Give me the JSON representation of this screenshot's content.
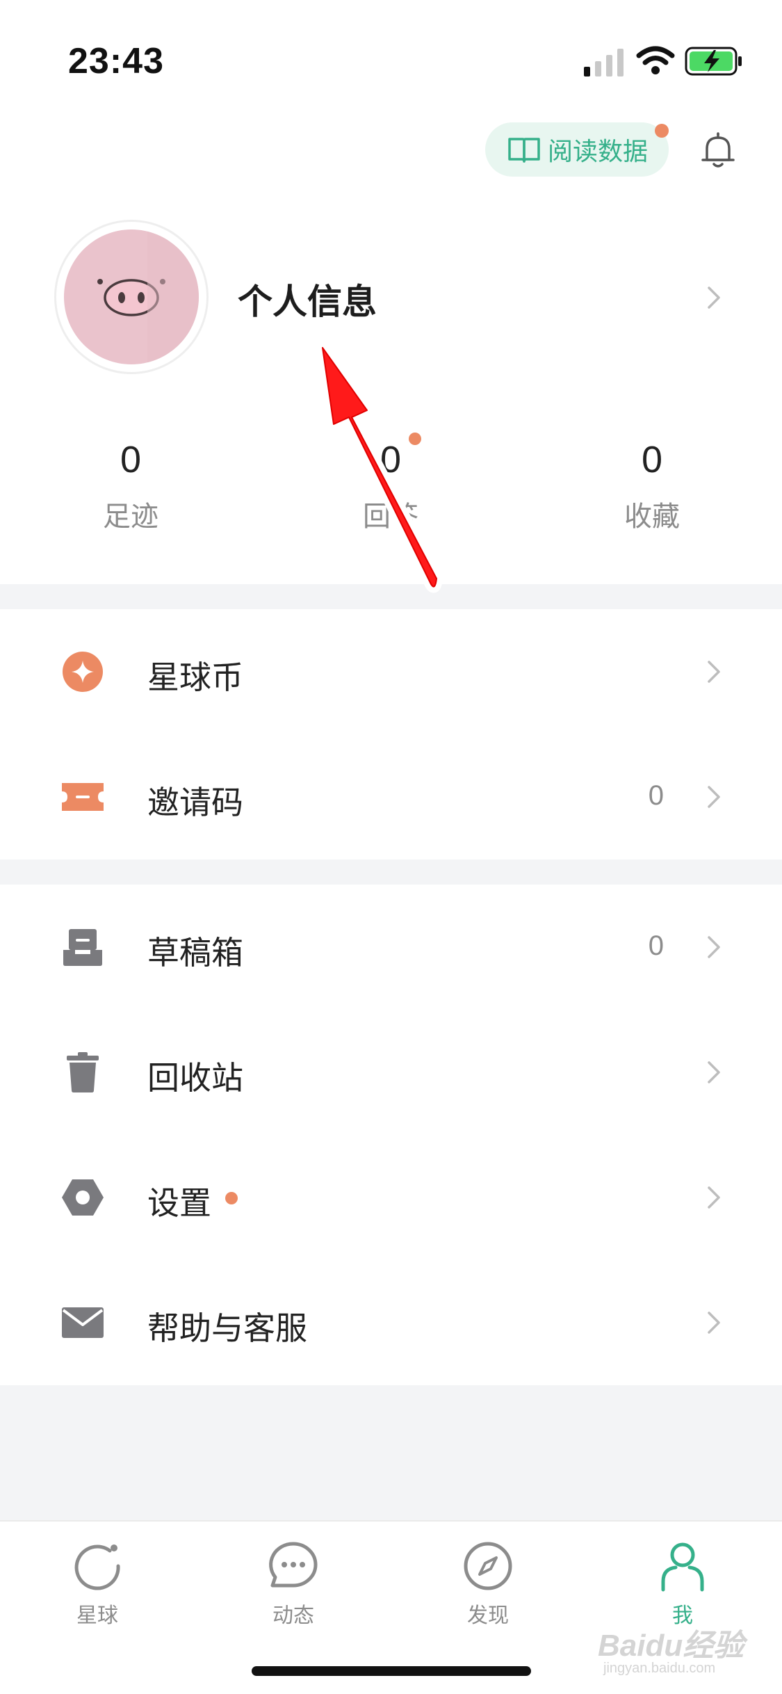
{
  "status_bar": {
    "time": "23:43"
  },
  "header": {
    "read_data_label": "阅读数据"
  },
  "profile": {
    "title": "个人信息"
  },
  "stats": [
    {
      "value": "0",
      "label": "足迹"
    },
    {
      "value": "0",
      "label": "回答"
    },
    {
      "value": "0",
      "label": "收藏"
    }
  ],
  "menu": {
    "coins": {
      "label": "星球币",
      "icon": "star-coin-icon"
    },
    "invite": {
      "label": "邀请码",
      "value": "0",
      "icon": "ticket-icon"
    },
    "drafts": {
      "label": "草稿箱",
      "value": "0",
      "icon": "inbox-tray-icon"
    },
    "trash": {
      "label": "回收站",
      "icon": "trash-icon"
    },
    "settings": {
      "label": "设置",
      "icon": "hexagon-settings-icon"
    },
    "help": {
      "label": "帮助与客服",
      "icon": "mail-icon"
    }
  },
  "tabs": [
    {
      "label": "星球",
      "icon": "planet-icon",
      "active": false
    },
    {
      "label": "动态",
      "icon": "chat-bubble-icon",
      "active": false
    },
    {
      "label": "发现",
      "icon": "compass-icon",
      "active": false
    },
    {
      "label": "我",
      "icon": "person-icon",
      "active": true
    }
  ],
  "colors": {
    "accent_green": "#35b08a",
    "accent_orange": "#ec8a63",
    "icon_gray": "#7a7a7e",
    "section_gap": "#f3f4f6",
    "avatar_pink": "#eac3cc",
    "annotation_red": "#ff1a1a"
  },
  "watermark": {
    "brand": "Baidu经验",
    "url": "jingyan.baidu.com"
  }
}
